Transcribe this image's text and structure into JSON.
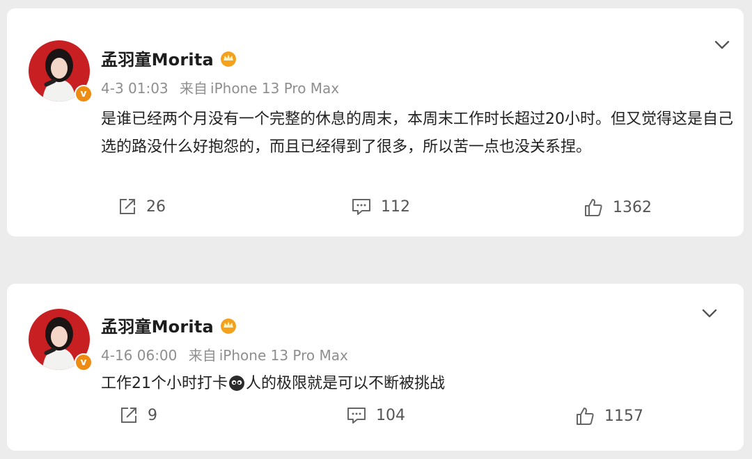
{
  "colors": {
    "badge": "#ee8b13",
    "vip": "#f4a21d",
    "text": "#222222",
    "meta": "#8e8e8e",
    "background": "#ececec"
  },
  "posts": [
    {
      "author": "孟羽童Morita",
      "timestamp": "4-3 01:03",
      "source_prefix": "来自",
      "device": "iPhone 13 Pro Max",
      "content": "是谁已经两个月没有一个完整的休息的周末，本周末工作时长超过20小时。但又觉得这是自己选的路没什么好抱怨的，而且已经得到了很多，所以苦一点也没关系捏。",
      "reposts": "26",
      "comments": "112",
      "likes": "1362"
    },
    {
      "author": "孟羽童Morita",
      "timestamp": "4-16 06:00",
      "source_prefix": "来自",
      "device": "iPhone 13 Pro Max",
      "content_before": "工作21个小时打卡",
      "content_after": "人的极限就是可以不断被挑战",
      "emoji_icon": "cute-face-emoji",
      "reposts": "9",
      "comments": "104",
      "likes": "1157"
    }
  ]
}
